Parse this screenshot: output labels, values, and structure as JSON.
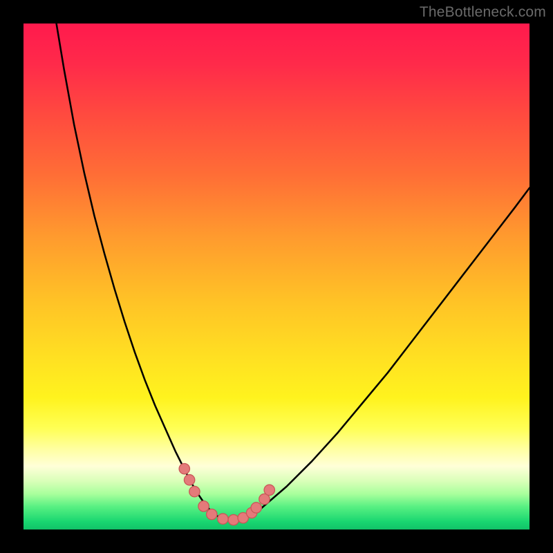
{
  "watermark": "TheBottleneck.com",
  "colors": {
    "frame": "#000000",
    "curve": "#000000",
    "marker_fill": "#e47a7a",
    "marker_stroke": "#c95858"
  },
  "gradient_stops": [
    {
      "offset": 0.0,
      "color": "#ff1a4d"
    },
    {
      "offset": 0.08,
      "color": "#ff2a4a"
    },
    {
      "offset": 0.18,
      "color": "#ff4a3f"
    },
    {
      "offset": 0.3,
      "color": "#ff6e36"
    },
    {
      "offset": 0.42,
      "color": "#ff9a2e"
    },
    {
      "offset": 0.55,
      "color": "#ffc326"
    },
    {
      "offset": 0.66,
      "color": "#ffe022"
    },
    {
      "offset": 0.74,
      "color": "#fff31e"
    },
    {
      "offset": 0.8,
      "color": "#ffff55"
    },
    {
      "offset": 0.845,
      "color": "#ffffa8"
    },
    {
      "offset": 0.875,
      "color": "#ffffd8"
    },
    {
      "offset": 0.905,
      "color": "#d8ffb8"
    },
    {
      "offset": 0.93,
      "color": "#a8ff9c"
    },
    {
      "offset": 0.955,
      "color": "#58f082"
    },
    {
      "offset": 0.985,
      "color": "#18d670"
    },
    {
      "offset": 1.0,
      "color": "#12c268"
    }
  ],
  "chart_data": {
    "type": "line",
    "title": "",
    "xlabel": "",
    "ylabel": "",
    "xlim": [
      0,
      100
    ],
    "ylim": [
      0,
      100
    ],
    "series": [
      {
        "name": "bottleneck-curve",
        "x": [
          6.5,
          8,
          10,
          12,
          14,
          16,
          18,
          20,
          22,
          24,
          26,
          28,
          30,
          31.5,
          33,
          34.5,
          36,
          37.5,
          39,
          41,
          43,
          47,
          52,
          57,
          62,
          67,
          72,
          77,
          82,
          87,
          92,
          97,
          100
        ],
        "y": [
          100,
          91,
          80,
          70.5,
          62,
          54.5,
          47.5,
          41,
          35,
          29.5,
          24.5,
          20,
          15.5,
          12.5,
          9.5,
          7,
          4.8,
          3.2,
          2.2,
          1.6,
          1.9,
          4.2,
          8.5,
          13.5,
          19,
          25,
          31,
          37.5,
          44,
          50.5,
          57,
          63.5,
          67.5
        ]
      }
    ],
    "markers": {
      "name": "highlighted-points",
      "points": [
        {
          "x": 31.8,
          "y": 12.0
        },
        {
          "x": 32.8,
          "y": 9.8
        },
        {
          "x": 33.8,
          "y": 7.5
        },
        {
          "x": 35.6,
          "y": 4.6
        },
        {
          "x": 37.2,
          "y": 3.0
        },
        {
          "x": 39.4,
          "y": 2.1
        },
        {
          "x": 41.5,
          "y": 1.9
        },
        {
          "x": 43.4,
          "y": 2.3
        },
        {
          "x": 45.1,
          "y": 3.3
        },
        {
          "x": 46.0,
          "y": 4.3
        },
        {
          "x": 47.6,
          "y": 6.0
        },
        {
          "x": 48.6,
          "y": 7.8
        }
      ]
    }
  }
}
